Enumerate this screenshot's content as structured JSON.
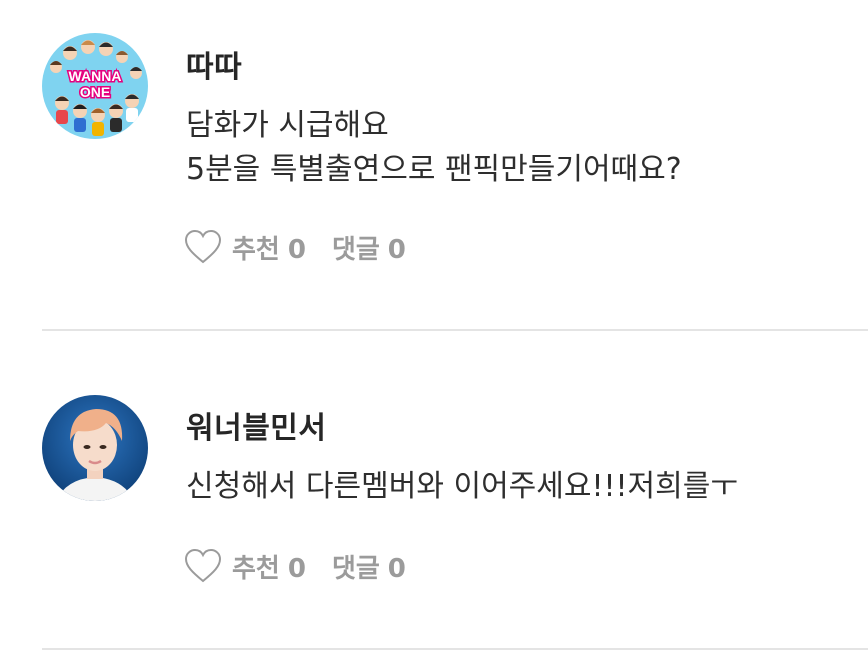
{
  "comments": [
    {
      "author": "따따",
      "lines": [
        "담화가 시급해요",
        "5분을 특별출연으로 팬픽만들기어때요?"
      ],
      "like_label": "추천",
      "like_count": "0",
      "reply_label": "댓글",
      "reply_count": "0",
      "avatar": {
        "kind": "wanna-one-group-cartoon",
        "text_top": "WANNA",
        "text_bottom": "ONE",
        "bg": "#7fd3f0"
      }
    },
    {
      "author": "워너블민서",
      "lines": [
        "신청해서 다른멤버와 이어주세요!!!저희를ㅜ"
      ],
      "like_label": "추천",
      "like_count": "0",
      "reply_label": "댓글",
      "reply_count": "0",
      "avatar": {
        "kind": "member-photo",
        "bg": "#0f4a8a"
      }
    }
  ],
  "colors": {
    "text": "#2e2e2e",
    "muted": "#9b9b9b",
    "divider": "#e4e4e4"
  }
}
